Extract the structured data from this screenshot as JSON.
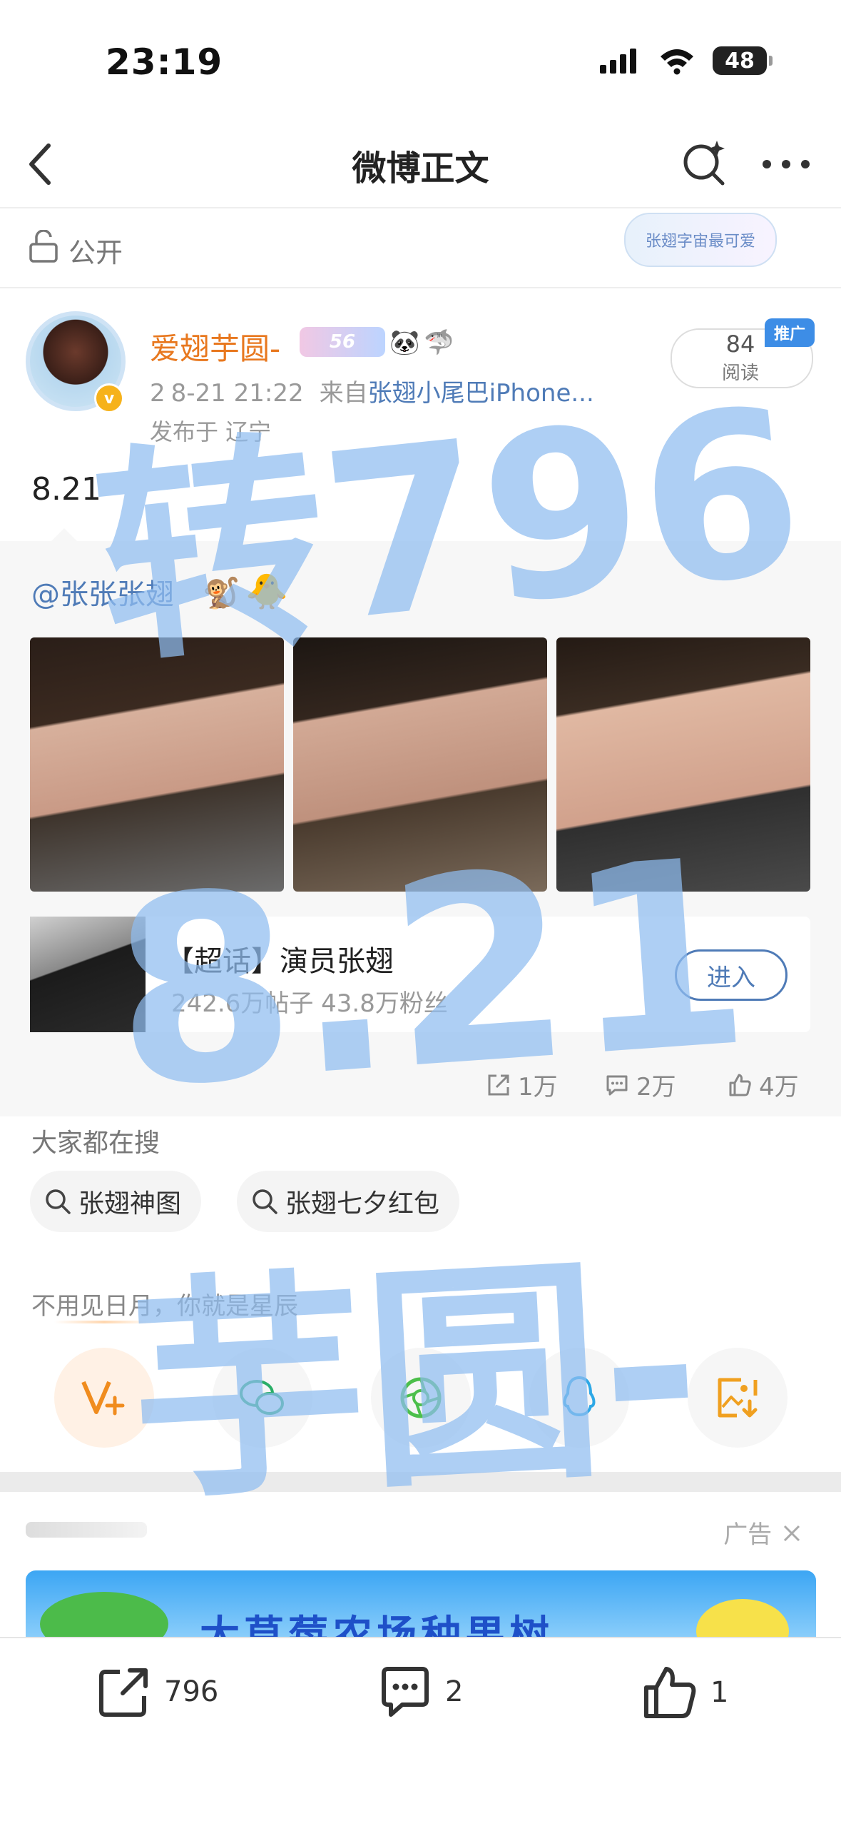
{
  "status_bar": {
    "time": "23:19",
    "battery": "48"
  },
  "nav": {
    "title": "微博正文"
  },
  "visibility": {
    "label": "公开",
    "sticker_text": "张翅字宙最可爱"
  },
  "post": {
    "author_name": "爱翅芋圆-",
    "fan_badge": "56",
    "time": "2",
    "time_rest": "8-21 21:22",
    "source_prefix": "来自",
    "source": "张翅小尾巴iPhone...",
    "location": "发布于 辽宁",
    "reads_count": "84",
    "reads_label": "阅读",
    "promo_label": "推广",
    "text": "8.21"
  },
  "repost": {
    "mention": "@张张张翅",
    "topic_title": "【超话】演员张翅",
    "topic_stats": "242.6万帖子 43.8万粉丝",
    "enter_label": "进入",
    "shares": "1万",
    "comments": "2万",
    "likes": "4万"
  },
  "search": {
    "label": "大家都在搜",
    "chips": [
      "张翅神图",
      "张翅七夕红包"
    ]
  },
  "quote": "不用见日月，你就是星辰",
  "ad": {
    "label": "广告",
    "banner_text": "大草莓农场种果树"
  },
  "bottom": {
    "reposts": "796",
    "comments": "2",
    "likes": "1"
  },
  "watermark": {
    "line1": "转796",
    "line2": "8.21",
    "line3": "芋圆-"
  },
  "colors": {
    "accent_blue": "#4f7bb7",
    "author_orange": "#e8781f",
    "watermark": "#8fbdf0"
  }
}
